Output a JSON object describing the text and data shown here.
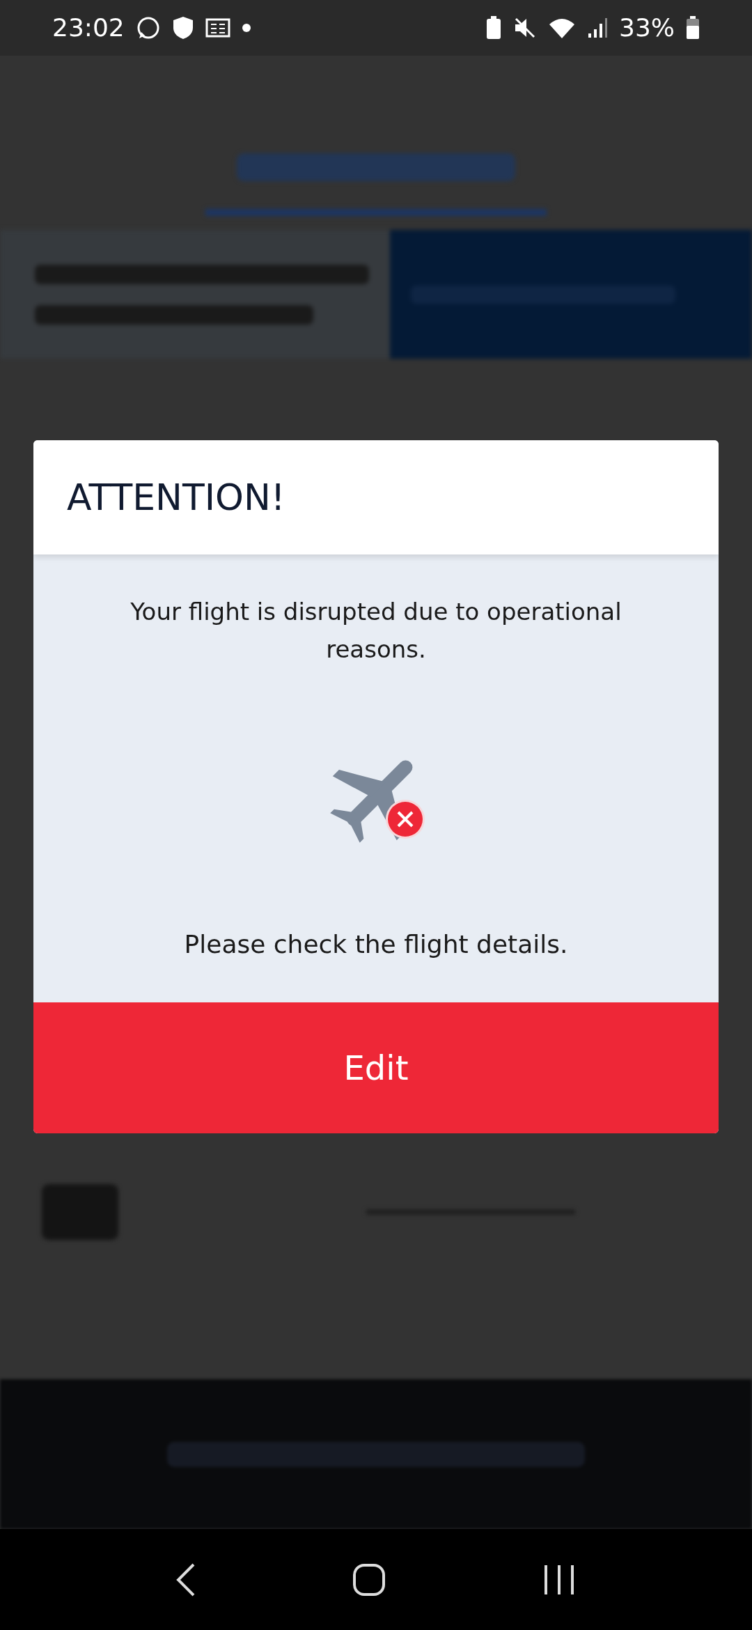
{
  "status_bar": {
    "time": "23:02",
    "battery": "33%"
  },
  "dialog": {
    "title": "ATTENTION!",
    "message": "Your flight is disrupted due to operational reasons.",
    "hint": "Please check the flight details.",
    "button": "Edit"
  }
}
